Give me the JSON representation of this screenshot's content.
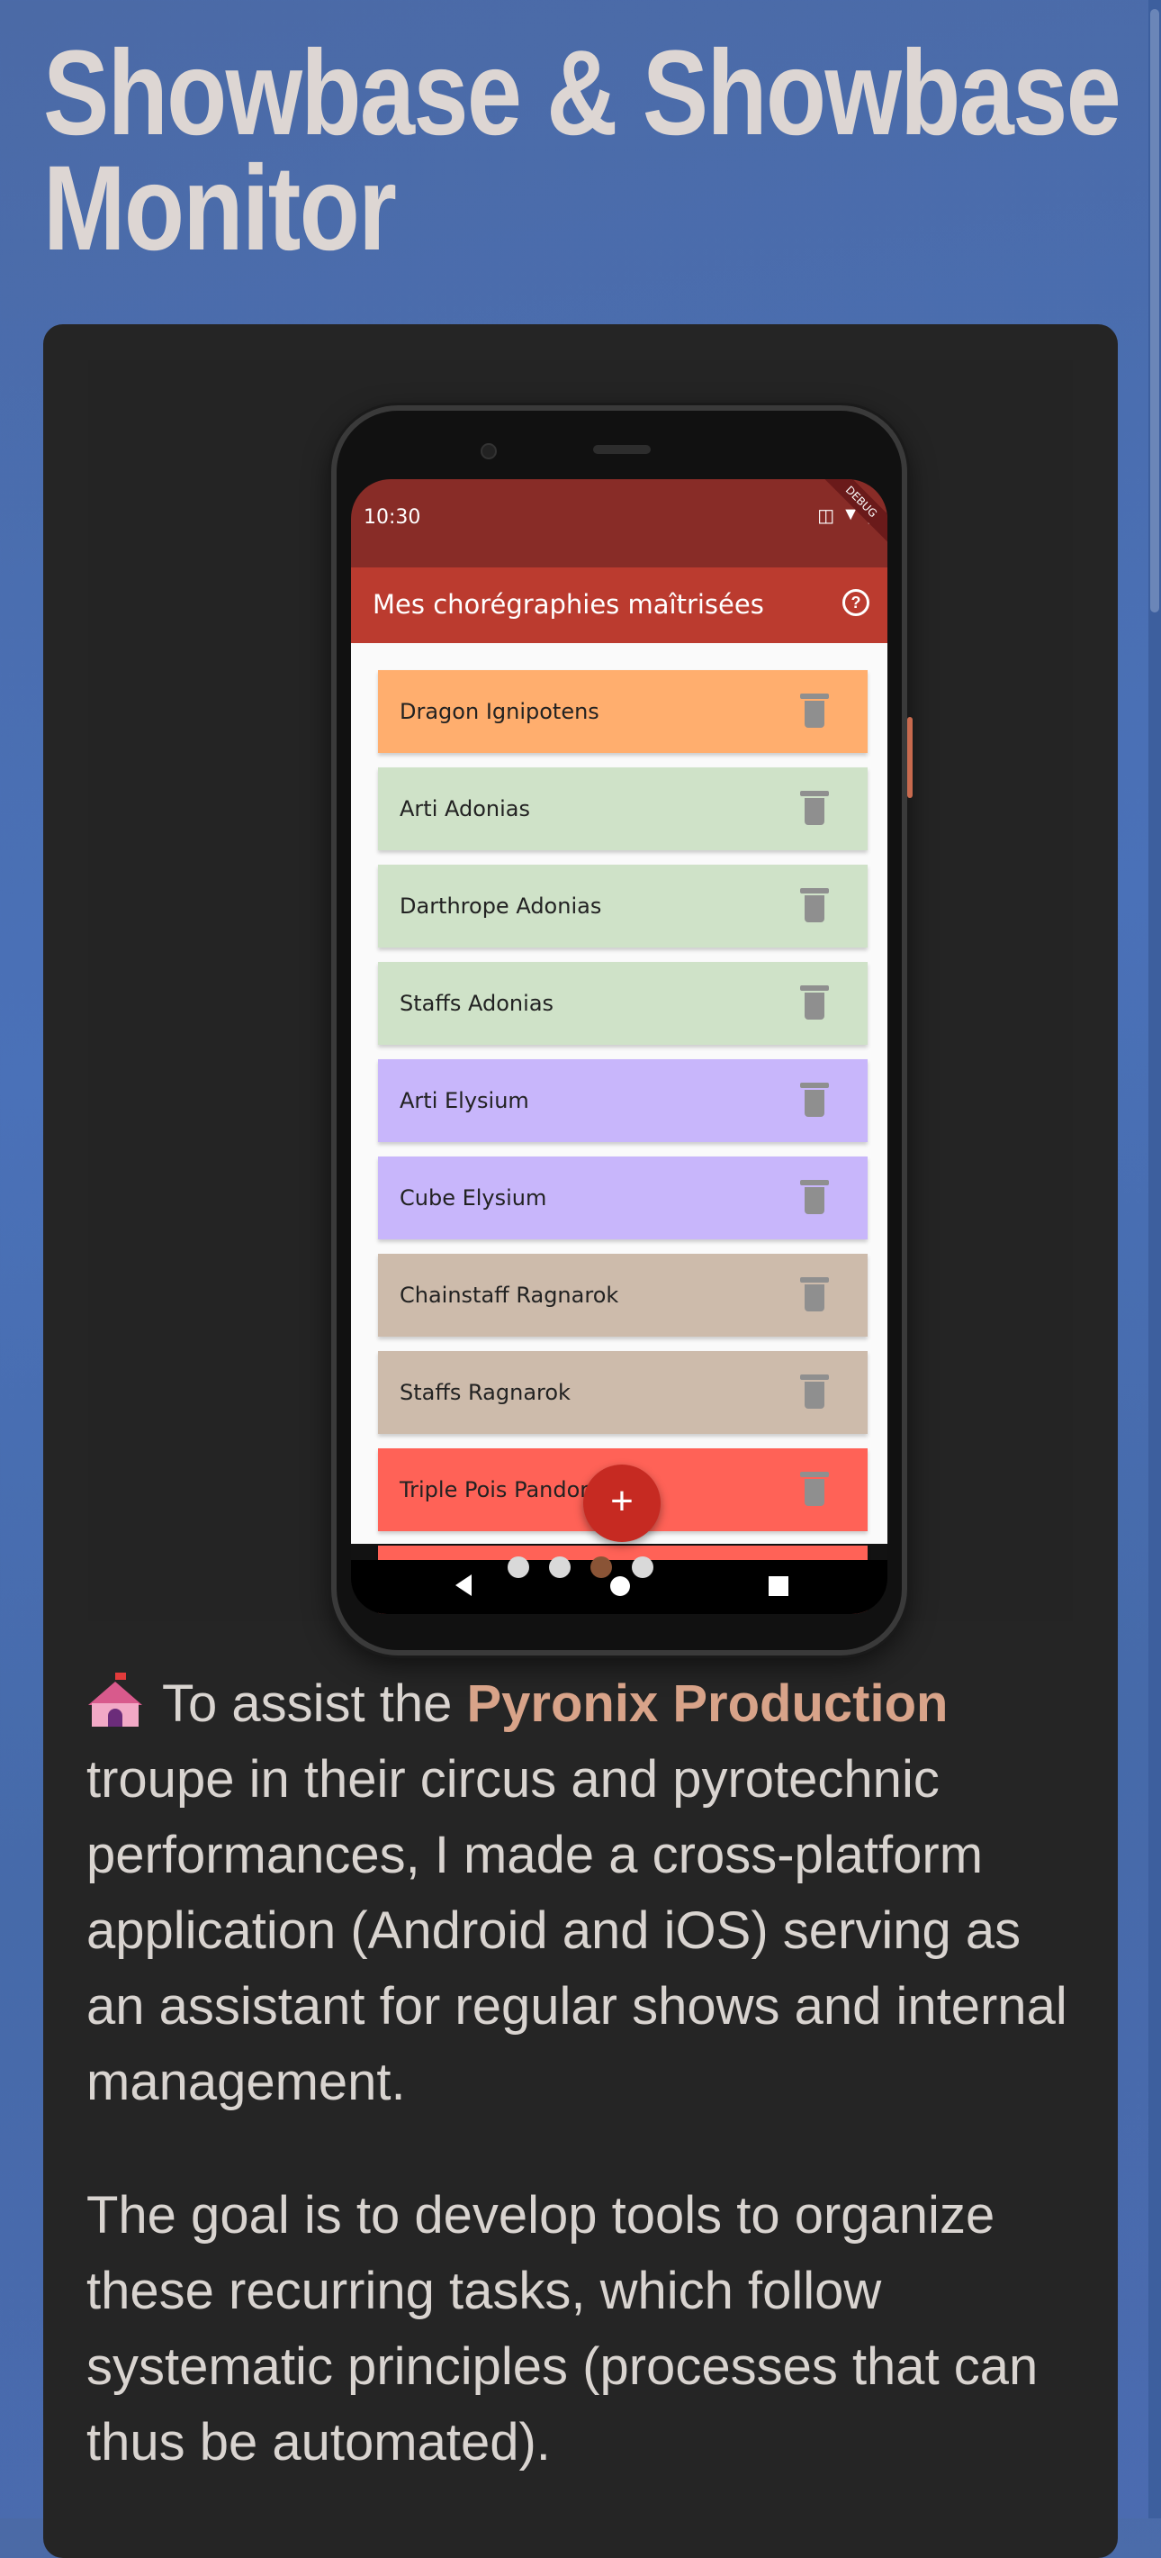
{
  "page": {
    "title_line1": "Showbase & Showbase",
    "title_line2": "Monitor"
  },
  "phone": {
    "status_time": "10:30",
    "debug_label": "DEBUG",
    "appbar_title": "Mes chorégraphies maîtrisées",
    "help_icon_glyph": "?",
    "fab_glyph": "+",
    "items": [
      {
        "label": "Dragon Ignipotens",
        "color": "#ffae6e"
      },
      {
        "label": "Arti Adonias",
        "color": "#cfe2c8"
      },
      {
        "label": "Darthrope Adonias",
        "color": "#cfe2c8"
      },
      {
        "label": "Staffs Adonias",
        "color": "#cfe2c8"
      },
      {
        "label": "Arti Elysium",
        "color": "#c8b6fb"
      },
      {
        "label": "Cube Elysium",
        "color": "#c8b6fb"
      },
      {
        "label": "Chainstaff Ragnarok",
        "color": "#cdbbab"
      },
      {
        "label": "Staffs Ragnarok",
        "color": "#cdbbab"
      },
      {
        "label": "Triple Pois Pandora",
        "color": "#ff6257"
      },
      {
        "label": "",
        "color": "#ff6257"
      }
    ]
  },
  "carousel": {
    "active_index": 2,
    "count": 4
  },
  "description": {
    "p1_before": "To assist the ",
    "p1_highlight": "Pyronix Production",
    "p1_after": " troupe in their circus and pyrotechnic performances, I made a cross-platform application (Android and iOS) serving as an assistant for regular shows and internal management.",
    "p2": "The goal is to develop tools to organize these recurring tasks, which follow systematic principles (processes that can thus be automated)."
  },
  "colors": {
    "background": "#4a6db0",
    "card": "#252525",
    "highlight": "#d8a389",
    "statusbar": "#882c27",
    "appbar": "#bb3b2f",
    "fab": "#c62a22"
  }
}
